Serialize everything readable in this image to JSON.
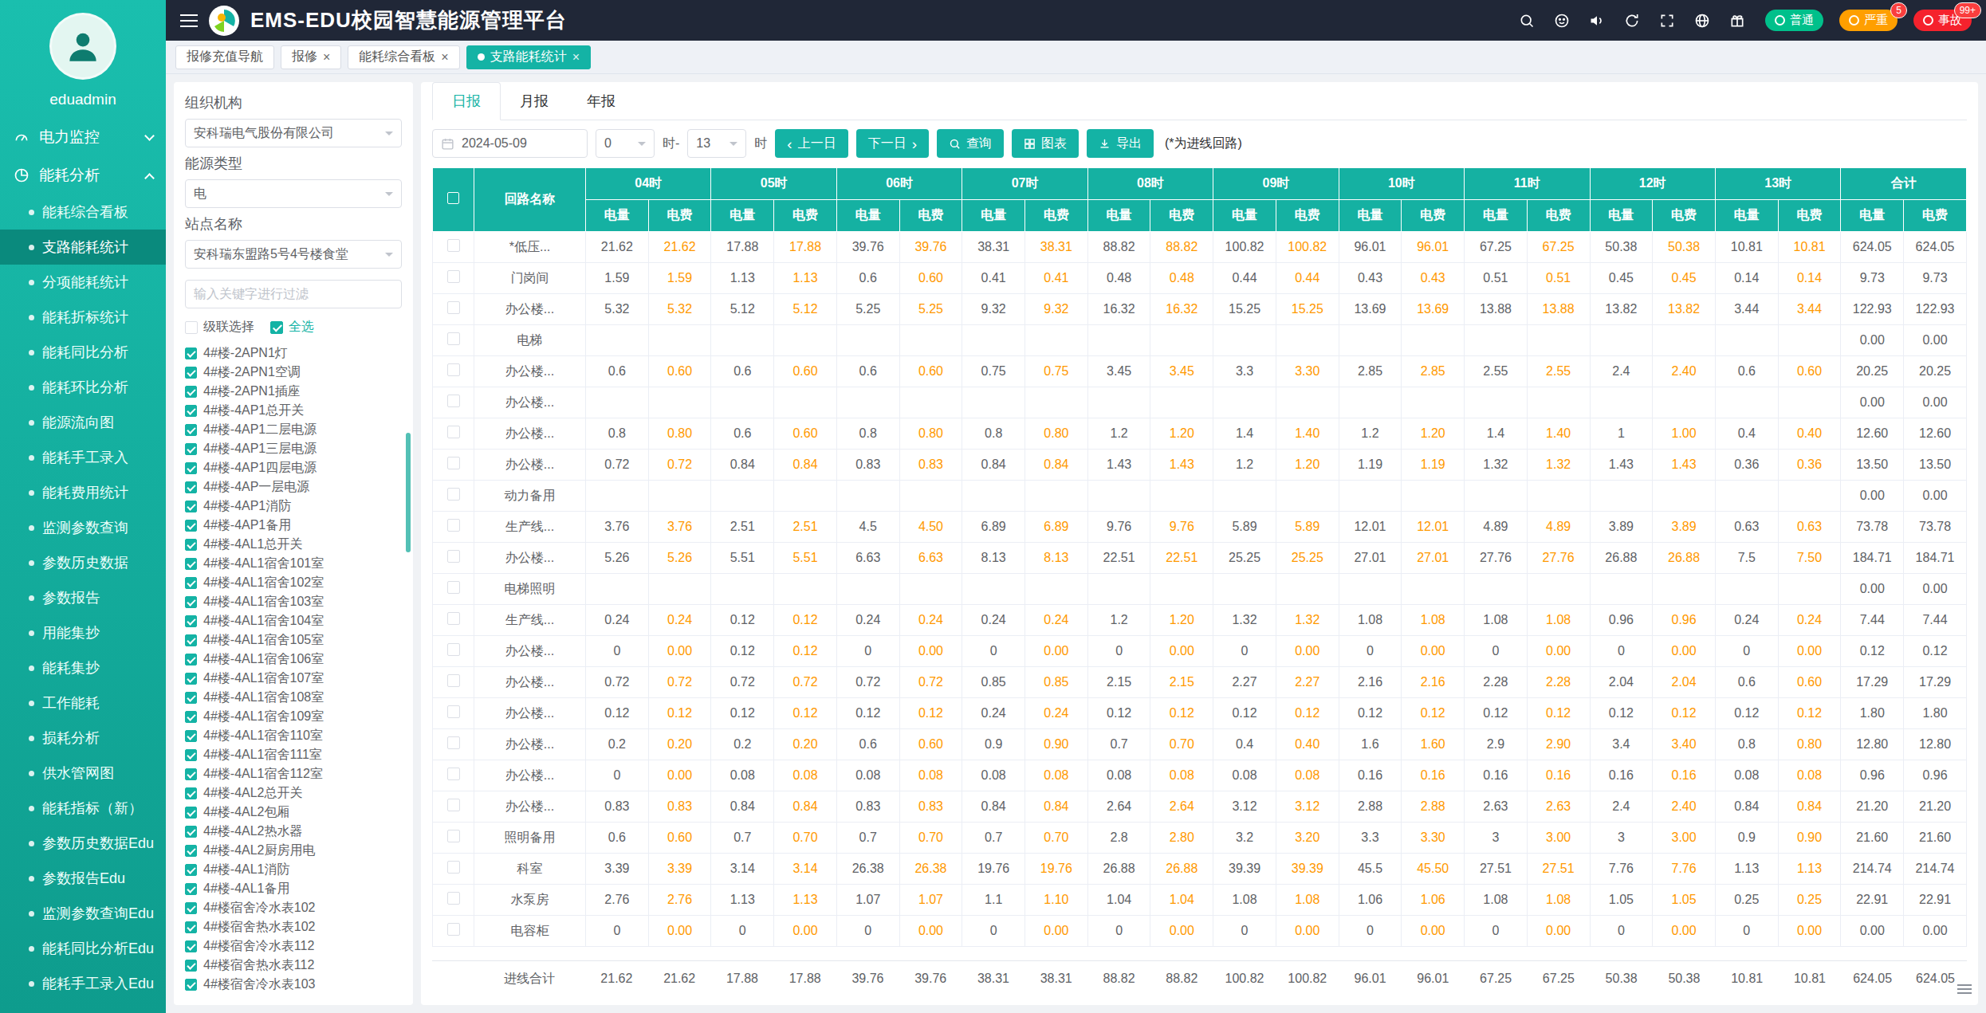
{
  "app": {
    "title": "EMS-EDU校园智慧能源管理平台"
  },
  "colors": {
    "primary": "#14b3a5",
    "fee_text": "#ff9900",
    "alarm_normal": "#00c08b",
    "alarm_serious": "#ff9f00",
    "alarm_accident": "#f5222d"
  },
  "header": {
    "alarms": [
      {
        "label": "普通",
        "badge": ""
      },
      {
        "label": "严重",
        "badge": "5"
      },
      {
        "label": "事故",
        "badge": "99+"
      }
    ]
  },
  "sidebar": {
    "username": "eduadmin",
    "menus": [
      {
        "label": "电力监控"
      },
      {
        "label": "能耗分析"
      }
    ],
    "active_submenu": "支路能耗统计",
    "submenu": [
      "能耗综合看板",
      "支路能耗统计",
      "分项能耗统计",
      "能耗折标统计",
      "能耗同比分析",
      "能耗环比分析",
      "能源流向图",
      "能耗手工录入",
      "能耗费用统计",
      "监测参数查询",
      "参数历史数据",
      "参数报告",
      "用能集抄",
      "能耗集抄",
      "工作能耗",
      "损耗分析",
      "供水管网图",
      "能耗指标（新）",
      "参数历史数据Edu",
      "参数报告Edu",
      "监测参数查询Edu",
      "能耗同比分析Edu",
      "能耗手工录入Edu"
    ]
  },
  "tabs": [
    {
      "label": "报修充值导航",
      "closable": false,
      "active": false
    },
    {
      "label": "报修",
      "closable": true,
      "active": false
    },
    {
      "label": "能耗综合看板",
      "closable": true,
      "active": false
    },
    {
      "label": "支路能耗统计",
      "closable": true,
      "active": true
    }
  ],
  "filter": {
    "org_label": "组织机构",
    "org_value": "安科瑞电气股份有限公司",
    "energy_label": "能源类型",
    "energy_value": "电",
    "station_label": "站点名称",
    "station_value": "安科瑞东盟路5号4号楼食堂",
    "search_placeholder": "输入关键字进行过滤",
    "cascade_label": "级联选择",
    "select_all_label": "全选",
    "tree": [
      "4#楼-2APN1灯",
      "4#楼-2APN1空调",
      "4#楼-2APN1插座",
      "4#楼-4AP1总开关",
      "4#楼-4AP1二层电源",
      "4#楼-4AP1三层电源",
      "4#楼-4AP1四层电源",
      "4#楼-4AP一层电源",
      "4#楼-4AP1消防",
      "4#楼-4AP1备用",
      "4#楼-4AL1总开关",
      "4#楼-4AL1宿舍101室",
      "4#楼-4AL1宿舍102室",
      "4#楼-4AL1宿舍103室",
      "4#楼-4AL1宿舍104室",
      "4#楼-4AL1宿舍105室",
      "4#楼-4AL1宿舍106室",
      "4#楼-4AL1宿舍107室",
      "4#楼-4AL1宿舍108室",
      "4#楼-4AL1宿舍109室",
      "4#楼-4AL1宿舍110室",
      "4#楼-4AL1宿舍111室",
      "4#楼-4AL1宿舍112室",
      "4#楼-4AL2总开关",
      "4#楼-4AL2包厢",
      "4#楼-4AL2热水器",
      "4#楼-4AL2厨房用电",
      "4#楼-4AL1消防",
      "4#楼-4AL1备用",
      "4#楼宿舍冷水表102",
      "4#楼宿舍热水表102",
      "4#楼宿舍冷水表112",
      "4#楼宿舍热水表112",
      "4#楼宿舍冷水表103"
    ]
  },
  "report": {
    "tabs": [
      "日报",
      "月报",
      "年报"
    ],
    "active_tab": "日报",
    "date": "2024-05-09",
    "hour_from": "0",
    "hour_from_suffix": "时-",
    "hour_to": "13",
    "hour_to_suffix": "时",
    "buttons": {
      "prev": "上一日",
      "next": "下一日",
      "query": "查询",
      "chart": "图表",
      "export": "导出"
    },
    "note": "(*为进线回路)"
  },
  "table": {
    "name_header": "回路名称",
    "hour_groups": [
      "04时",
      "05时",
      "06时",
      "07时",
      "08时",
      "09时",
      "10时",
      "11时",
      "12时",
      "13时",
      "合计"
    ],
    "sub_headers": [
      "电量",
      "电费"
    ],
    "rows": [
      {
        "name": "*低压...",
        "values": [
          "21.62",
          "21.62",
          "17.88",
          "17.88",
          "39.76",
          "39.76",
          "38.31",
          "38.31",
          "88.82",
          "88.82",
          "100.82",
          "100.82",
          "96.01",
          "96.01",
          "67.25",
          "67.25",
          "50.38",
          "50.38",
          "10.81",
          "10.81",
          "624.05",
          "624.05"
        ]
      },
      {
        "name": "门岗间",
        "values": [
          "1.59",
          "1.59",
          "1.13",
          "1.13",
          "0.6",
          "0.60",
          "0.41",
          "0.41",
          "0.48",
          "0.48",
          "0.44",
          "0.44",
          "0.43",
          "0.43",
          "0.51",
          "0.51",
          "0.45",
          "0.45",
          "0.14",
          "0.14",
          "9.73",
          "9.73"
        ]
      },
      {
        "name": "办公楼...",
        "values": [
          "5.32",
          "5.32",
          "5.12",
          "5.12",
          "5.25",
          "5.25",
          "9.32",
          "9.32",
          "16.32",
          "16.32",
          "15.25",
          "15.25",
          "13.69",
          "13.69",
          "13.88",
          "13.88",
          "13.82",
          "13.82",
          "3.44",
          "3.44",
          "122.93",
          "122.93"
        ]
      },
      {
        "name": "电梯",
        "values": [
          "",
          "",
          "",
          "",
          "",
          "",
          "",
          "",
          "",
          "",
          "",
          "",
          "",
          "",
          "",
          "",
          "",
          "",
          "",
          "",
          "0.00",
          "0.00"
        ]
      },
      {
        "name": "办公楼...",
        "values": [
          "0.6",
          "0.60",
          "0.6",
          "0.60",
          "0.6",
          "0.60",
          "0.75",
          "0.75",
          "3.45",
          "3.45",
          "3.3",
          "3.30",
          "2.85",
          "2.85",
          "2.55",
          "2.55",
          "2.4",
          "2.40",
          "0.6",
          "0.60",
          "20.25",
          "20.25"
        ]
      },
      {
        "name": "办公楼...",
        "values": [
          "",
          "",
          "",
          "",
          "",
          "",
          "",
          "",
          "",
          "",
          "",
          "",
          "",
          "",
          "",
          "",
          "",
          "",
          "",
          "",
          "0.00",
          "0.00"
        ]
      },
      {
        "name": "办公楼...",
        "values": [
          "0.8",
          "0.80",
          "0.6",
          "0.60",
          "0.8",
          "0.80",
          "0.8",
          "0.80",
          "1.2",
          "1.20",
          "1.4",
          "1.40",
          "1.2",
          "1.20",
          "1.4",
          "1.40",
          "1",
          "1.00",
          "0.4",
          "0.40",
          "12.60",
          "12.60"
        ]
      },
      {
        "name": "办公楼...",
        "values": [
          "0.72",
          "0.72",
          "0.84",
          "0.84",
          "0.83",
          "0.83",
          "0.84",
          "0.84",
          "1.43",
          "1.43",
          "1.2",
          "1.20",
          "1.19",
          "1.19",
          "1.32",
          "1.32",
          "1.43",
          "1.43",
          "0.36",
          "0.36",
          "13.50",
          "13.50"
        ]
      },
      {
        "name": "动力备用",
        "values": [
          "",
          "",
          "",
          "",
          "",
          "",
          "",
          "",
          "",
          "",
          "",
          "",
          "",
          "",
          "",
          "",
          "",
          "",
          "",
          "",
          "0.00",
          "0.00"
        ]
      },
      {
        "name": "生产线...",
        "values": [
          "3.76",
          "3.76",
          "2.51",
          "2.51",
          "4.5",
          "4.50",
          "6.89",
          "6.89",
          "9.76",
          "9.76",
          "5.89",
          "5.89",
          "12.01",
          "12.01",
          "4.89",
          "4.89",
          "3.89",
          "3.89",
          "0.63",
          "0.63",
          "73.78",
          "73.78"
        ]
      },
      {
        "name": "办公楼...",
        "values": [
          "5.26",
          "5.26",
          "5.51",
          "5.51",
          "6.63",
          "6.63",
          "8.13",
          "8.13",
          "22.51",
          "22.51",
          "25.25",
          "25.25",
          "27.01",
          "27.01",
          "27.76",
          "27.76",
          "26.88",
          "26.88",
          "7.5",
          "7.50",
          "184.71",
          "184.71"
        ]
      },
      {
        "name": "电梯照明",
        "values": [
          "",
          "",
          "",
          "",
          "",
          "",
          "",
          "",
          "",
          "",
          "",
          "",
          "",
          "",
          "",
          "",
          "",
          "",
          "",
          "",
          "0.00",
          "0.00"
        ]
      },
      {
        "name": "生产线...",
        "values": [
          "0.24",
          "0.24",
          "0.12",
          "0.12",
          "0.24",
          "0.24",
          "0.24",
          "0.24",
          "1.2",
          "1.20",
          "1.32",
          "1.32",
          "1.08",
          "1.08",
          "1.08",
          "1.08",
          "0.96",
          "0.96",
          "0.24",
          "0.24",
          "7.44",
          "7.44"
        ]
      },
      {
        "name": "办公楼...",
        "values": [
          "0",
          "0.00",
          "0.12",
          "0.12",
          "0",
          "0.00",
          "0",
          "0.00",
          "0",
          "0.00",
          "0",
          "0.00",
          "0",
          "0.00",
          "0",
          "0.00",
          "0",
          "0.00",
          "0",
          "0.00",
          "0.12",
          "0.12"
        ]
      },
      {
        "name": "办公楼...",
        "values": [
          "0.72",
          "0.72",
          "0.72",
          "0.72",
          "0.72",
          "0.72",
          "0.85",
          "0.85",
          "2.15",
          "2.15",
          "2.27",
          "2.27",
          "2.16",
          "2.16",
          "2.28",
          "2.28",
          "2.04",
          "2.04",
          "0.6",
          "0.60",
          "17.29",
          "17.29"
        ]
      },
      {
        "name": "办公楼...",
        "values": [
          "0.12",
          "0.12",
          "0.12",
          "0.12",
          "0.12",
          "0.12",
          "0.24",
          "0.24",
          "0.12",
          "0.12",
          "0.12",
          "0.12",
          "0.12",
          "0.12",
          "0.12",
          "0.12",
          "0.12",
          "0.12",
          "0.12",
          "0.12",
          "1.80",
          "1.80"
        ]
      },
      {
        "name": "办公楼...",
        "values": [
          "0.2",
          "0.20",
          "0.2",
          "0.20",
          "0.6",
          "0.60",
          "0.9",
          "0.90",
          "0.7",
          "0.70",
          "0.4",
          "0.40",
          "1.6",
          "1.60",
          "2.9",
          "2.90",
          "3.4",
          "3.40",
          "0.8",
          "0.80",
          "12.80",
          "12.80"
        ]
      },
      {
        "name": "办公楼...",
        "values": [
          "0",
          "0.00",
          "0.08",
          "0.08",
          "0.08",
          "0.08",
          "0.08",
          "0.08",
          "0.08",
          "0.08",
          "0.08",
          "0.08",
          "0.16",
          "0.16",
          "0.16",
          "0.16",
          "0.16",
          "0.16",
          "0.08",
          "0.08",
          "0.96",
          "0.96"
        ]
      },
      {
        "name": "办公楼...",
        "values": [
          "0.83",
          "0.83",
          "0.84",
          "0.84",
          "0.83",
          "0.83",
          "0.84",
          "0.84",
          "2.64",
          "2.64",
          "3.12",
          "3.12",
          "2.88",
          "2.88",
          "2.63",
          "2.63",
          "2.4",
          "2.40",
          "0.84",
          "0.84",
          "21.20",
          "21.20"
        ]
      },
      {
        "name": "照明备用",
        "values": [
          "0.6",
          "0.60",
          "0.7",
          "0.70",
          "0.7",
          "0.70",
          "0.7",
          "0.70",
          "2.8",
          "2.80",
          "3.2",
          "3.20",
          "3.3",
          "3.30",
          "3",
          "3.00",
          "3",
          "3.00",
          "0.9",
          "0.90",
          "21.60",
          "21.60"
        ]
      },
      {
        "name": "科室",
        "values": [
          "3.39",
          "3.39",
          "3.14",
          "3.14",
          "26.38",
          "26.38",
          "19.76",
          "19.76",
          "26.88",
          "26.88",
          "39.39",
          "39.39",
          "45.5",
          "45.50",
          "27.51",
          "27.51",
          "7.76",
          "7.76",
          "1.13",
          "1.13",
          "214.74",
          "214.74"
        ]
      },
      {
        "name": "水泵房",
        "values": [
          "2.76",
          "2.76",
          "1.13",
          "1.13",
          "1.07",
          "1.07",
          "1.1",
          "1.10",
          "1.04",
          "1.04",
          "1.08",
          "1.08",
          "1.06",
          "1.06",
          "1.08",
          "1.08",
          "1.05",
          "1.05",
          "0.25",
          "0.25",
          "22.91",
          "22.91"
        ]
      },
      {
        "name": "电容柜",
        "values": [
          "0",
          "0.00",
          "0",
          "0.00",
          "0",
          "0.00",
          "0",
          "0.00",
          "0",
          "0.00",
          "0",
          "0.00",
          "0",
          "0.00",
          "0",
          "0.00",
          "0",
          "0.00",
          "0",
          "0.00",
          "0.00",
          "0.00"
        ]
      }
    ],
    "footer": {
      "name": "进线合计",
      "values": [
        "21.62",
        "21.62",
        "17.88",
        "17.88",
        "39.76",
        "39.76",
        "38.31",
        "38.31",
        "88.82",
        "88.82",
        "100.82",
        "100.82",
        "96.01",
        "96.01",
        "67.25",
        "67.25",
        "50.38",
        "50.38",
        "10.81",
        "10.81",
        "624.05",
        "624.05"
      ]
    }
  }
}
